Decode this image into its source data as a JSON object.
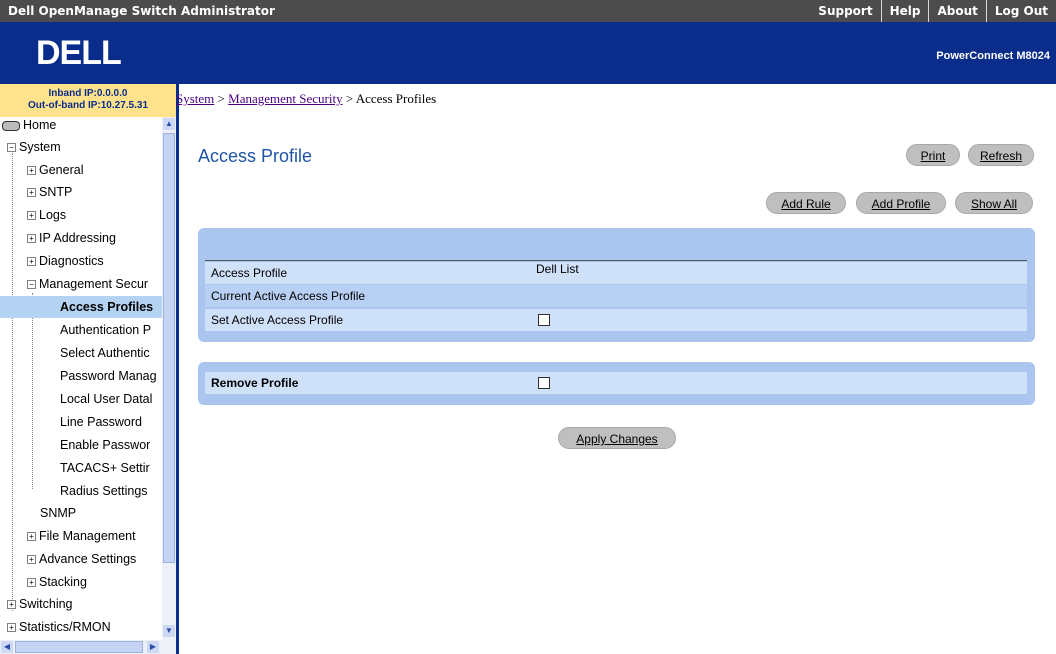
{
  "topbar": {
    "title": "Dell OpenManage Switch Administrator",
    "links": [
      "Support",
      "Help",
      "About",
      "Log Out"
    ]
  },
  "banner": {
    "logo_text": "DELL",
    "model": "PowerConnect M8024"
  },
  "sidebar": {
    "inband_ip": "Inband IP:0.0.0.0",
    "oob_ip": "Out-of-band IP:10.27.5.31",
    "tree": [
      {
        "label": "Home",
        "type": "home"
      },
      {
        "label": "System",
        "type": "minus"
      },
      {
        "label": "General",
        "type": "plus"
      },
      {
        "label": "SNTP",
        "type": "plus"
      },
      {
        "label": "Logs",
        "type": "plus"
      },
      {
        "label": "IP Addressing",
        "type": "plus"
      },
      {
        "label": "Diagnostics",
        "type": "plus"
      },
      {
        "label": "Management Secur",
        "type": "minus"
      },
      {
        "label": "Access Profiles",
        "type": "leaf",
        "selected": true
      },
      {
        "label": "Authentication P",
        "type": "leaf"
      },
      {
        "label": "Select Authentic",
        "type": "leaf"
      },
      {
        "label": "Password Manag",
        "type": "leaf"
      },
      {
        "label": "Local User Datal",
        "type": "leaf"
      },
      {
        "label": "Line Password",
        "type": "leaf"
      },
      {
        "label": "Enable Passwor",
        "type": "leaf"
      },
      {
        "label": "TACACS+ Settir",
        "type": "leaf"
      },
      {
        "label": "Radius Settings",
        "type": "leaf"
      },
      {
        "label": "SNMP",
        "type": "plain"
      },
      {
        "label": "File Management",
        "type": "plus"
      },
      {
        "label": "Advance Settings",
        "type": "plus"
      },
      {
        "label": "Stacking",
        "type": "plus"
      },
      {
        "label": "Switching",
        "type": "plus"
      },
      {
        "label": "Statistics/RMON",
        "type": "plus"
      }
    ]
  },
  "breadcrumb": {
    "system": "System",
    "sep": " > ",
    "mgmt": "Management Security",
    "current": "Access Profiles"
  },
  "page": {
    "title": "Access Profile",
    "print": "Print",
    "refresh": "Refresh",
    "add_rule": "Add Rule",
    "add_profile": "Add Profile",
    "show_all": "Show All",
    "rows": {
      "access_profile_label": "Access Profile",
      "access_profile_value": "Dell List",
      "current_active_label": "Current Active Access Profile",
      "current_active_value": "",
      "set_active_label": "Set Active Access Profile",
      "set_active_checked": false
    },
    "remove_label": "Remove Profile",
    "remove_checked": false,
    "apply": "Apply Changes"
  },
  "colors": {
    "banner": "#0a2d8c",
    "ipinfo_bg": "#ffe38c",
    "panel": "#aac6ef",
    "row": "#cfe0f9",
    "title": "#1f55a6",
    "selected": "#b4d3f3"
  }
}
